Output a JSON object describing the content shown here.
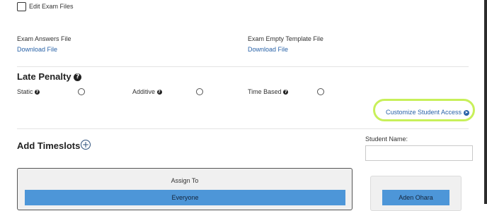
{
  "edit_exam_files": {
    "label": "Edit Exam Files",
    "checked": false
  },
  "files": [
    {
      "label": "Exam Answers File",
      "link": "Download File"
    },
    {
      "label": "Exam Empty Template File",
      "link": "Download File"
    }
  ],
  "late_penalty": {
    "title": "Late Penalty",
    "help_icon": "question-circle-icon",
    "options": [
      {
        "label": "Static",
        "selected": false
      },
      {
        "label": "Additive",
        "selected": false
      },
      {
        "label": "Time Based",
        "selected": false
      }
    ]
  },
  "customize_access": {
    "label": "Customize Student Access",
    "icon": "arrow-right-circle-icon",
    "highlight_color": "#c8f05a"
  },
  "timeslots": {
    "title": "Add Timeslots",
    "add_icon": "plus-circle-icon"
  },
  "student_name": {
    "label": "Student Name:",
    "value": ""
  },
  "assign": {
    "title": "Assign To",
    "everyone_label": "Everyone"
  },
  "student_button": {
    "label": "Aden Ohara"
  },
  "colors": {
    "link": "#2a63a8",
    "button": "#4d96d8",
    "highlight": "#c8f05a"
  }
}
